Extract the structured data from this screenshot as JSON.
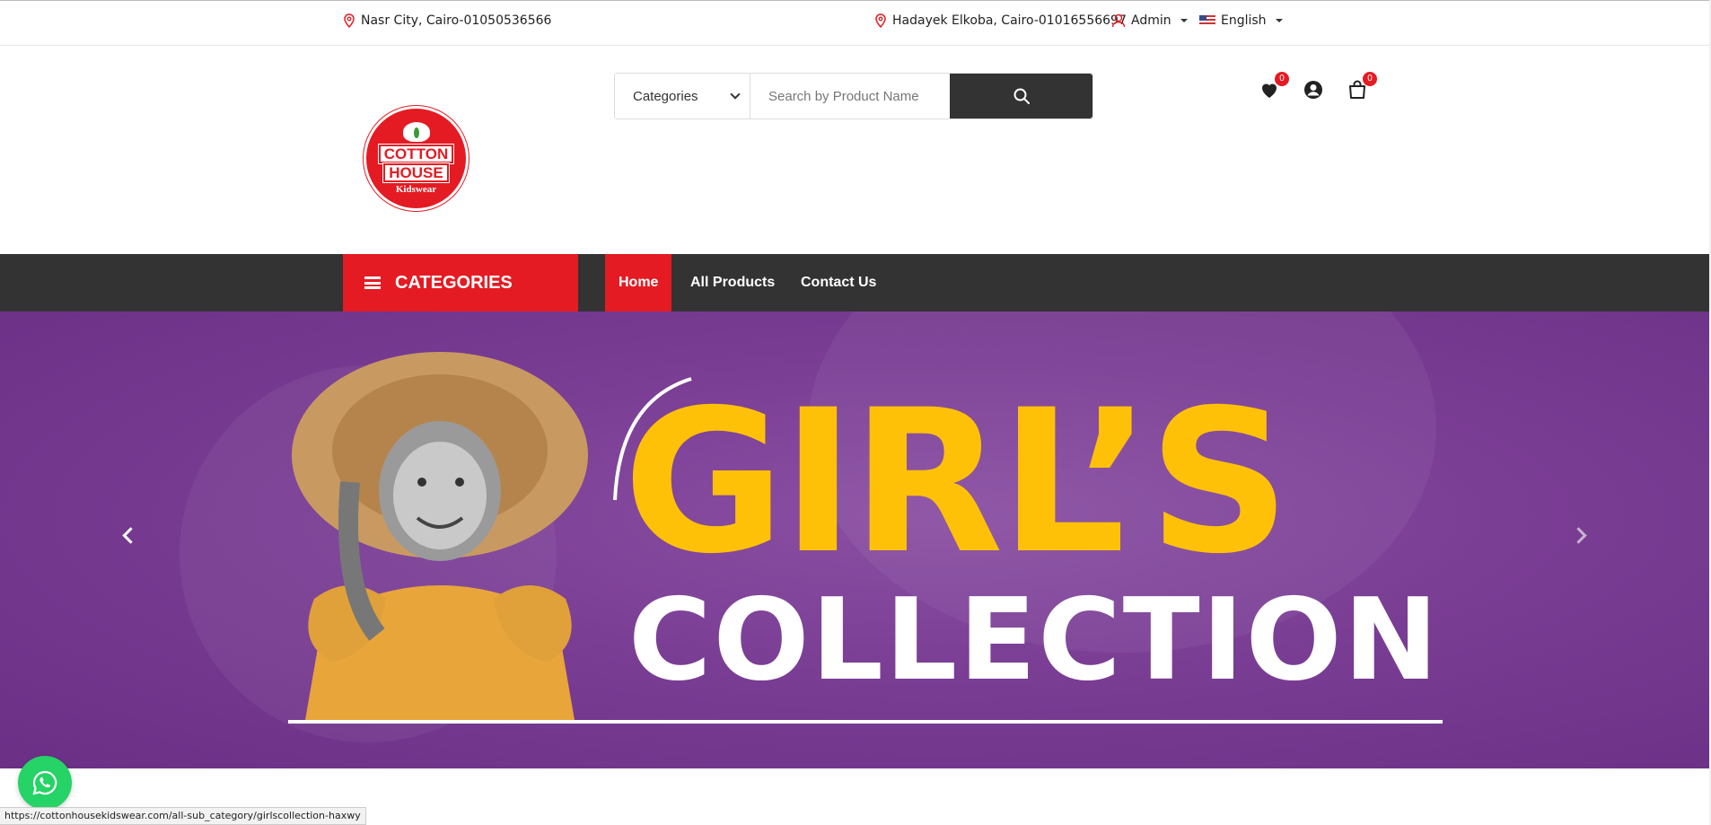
{
  "topbar": {
    "branch1": "Nasr City, Cairo-01050536566",
    "branch2": "Hadayek Elkoba, Cairo-01016556697",
    "user": "Admin",
    "language": "English"
  },
  "header": {
    "logo": {
      "line1": "COTTON",
      "line2": "HOUSE",
      "line3": "Kidswear"
    },
    "search": {
      "category_label": "Categories",
      "placeholder": "Search by Product Name"
    },
    "wishlist_count": "0",
    "cart_count": "0"
  },
  "nav": {
    "categories_label": "CATEGORIES",
    "links": [
      "Home",
      "All Products",
      "Contact Us"
    ]
  },
  "hero": {
    "title_line1": "GIRL’S",
    "title_line2": "COLLECTION"
  },
  "status_url": "https://cottonhousekidswear.com/all-sub_category/girlscollection-haxwy",
  "colors": {
    "brand_red": "#e41b22",
    "nav_dark": "#333333",
    "hero_purple": "#7a3d94",
    "title_yellow": "#ffc107",
    "whatsapp_green": "#25d366"
  }
}
